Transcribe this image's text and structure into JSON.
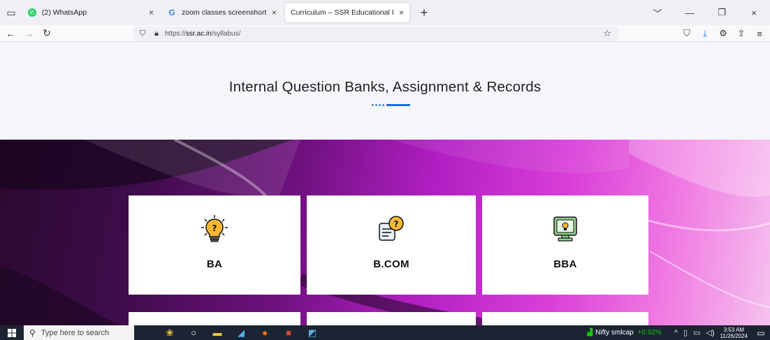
{
  "browser": {
    "tabs": [
      {
        "label": "(2) WhatsApp",
        "favicon": "whatsapp-icon",
        "close": "×",
        "active": false
      },
      {
        "label": "zoom classes screenshorts - Go",
        "favicon": "google-icon",
        "close": "×",
        "active": false
      },
      {
        "label": "Curriculum – SSR Educational Instit",
        "favicon": "none",
        "close": "×",
        "active": true
      }
    ],
    "new_tab": "+",
    "url_prefix": "https://",
    "url_host": "ssr.ac.in",
    "url_path": "/syllabus/",
    "window_controls": {
      "minimize": "—",
      "restore": "❐",
      "close": "×"
    }
  },
  "page": {
    "section_title": "Internal Question Banks, Assignment & Records",
    "cards": [
      {
        "label": "BA",
        "icon": "lightbulb-question-icon"
      },
      {
        "label": "B.COM",
        "icon": "document-question-icon"
      },
      {
        "label": "BBA",
        "icon": "monitor-idea-icon"
      }
    ],
    "colors": {
      "accent": "#1e6fd9",
      "hero_dark": "#2a0a2e",
      "hero_mid": "#b11fc2",
      "hero_light": "#f5c2ee"
    }
  },
  "taskbar": {
    "search_placeholder": "Type here to search",
    "ticker_name": "Nifty smlcap",
    "ticker_change": "+0.92%",
    "time": "3:53 AM",
    "date": "11/26/2024"
  }
}
